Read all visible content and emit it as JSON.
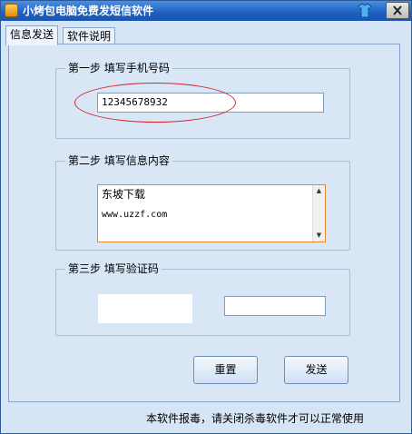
{
  "window": {
    "title": "小烤包电脑免费发短信软件",
    "close_label": "✕",
    "icons": {
      "app": "app-icon",
      "skin": "tshirt-icon",
      "close": "close-icon"
    },
    "colors": {
      "title_bar": "#1d5fc0",
      "highlight_ellipse": "#d81f2a"
    }
  },
  "tabs": [
    {
      "label": "信息发送",
      "active": true
    },
    {
      "label": "软件说明",
      "active": false
    }
  ],
  "step1": {
    "legend": "第一步  填写手机号码",
    "phone_value": "12345678932"
  },
  "step2": {
    "legend": "第二步  填写信息内容",
    "message_line1": "东坡下载",
    "message_line2": "www.uzzf.com",
    "scroll_up": "▲",
    "scroll_down": "▼"
  },
  "step3": {
    "legend": "第三步  填写验证码",
    "captcha_value": ""
  },
  "buttons": {
    "reset": "重置",
    "send": "发送"
  },
  "footer": {
    "notice": "本软件报毒，请关闭杀毒软件才可以正常使用"
  }
}
